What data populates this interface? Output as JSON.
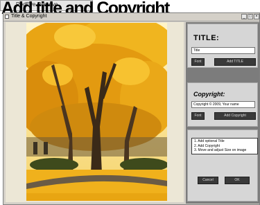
{
  "background": {
    "menu_item": "RedEye Remove",
    "big_title": "Add title and Copyright"
  },
  "window": {
    "title": "Title & Copyright",
    "controls": [
      "_",
      "□",
      "×"
    ]
  },
  "panel": {
    "title_section": {
      "heading": "TITLE:",
      "input_value": "Title",
      "font_button": "Font",
      "add_button": "Add TITLE"
    },
    "copyright_section": {
      "heading": "Copyright:",
      "input_value": "Copyright © 2009, Your name",
      "font_button": "Font",
      "add_button": "Add Copyright"
    },
    "instructions": [
      "1. Add optional Title",
      "2. Add Copyright",
      "3. Move and adjust Size on image"
    ],
    "cancel_button": "Cancel",
    "ok_button": "OK"
  },
  "colors": {
    "panel_bg": "#7c7c7c",
    "section_bg": "#d6d6d6",
    "button_bg": "#3a3a3a",
    "canvas_bg": "#ece7d6"
  }
}
